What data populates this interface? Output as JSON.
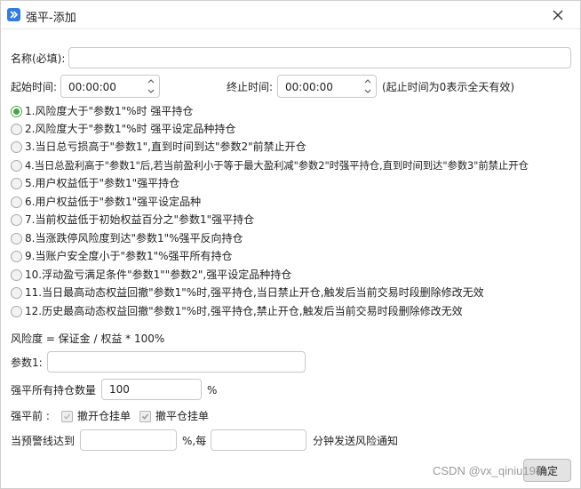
{
  "window": {
    "title": "强平-添加",
    "close_icon": "close-icon"
  },
  "name_field": {
    "label": "名称(必填):",
    "value": ""
  },
  "time": {
    "start_label": "起始时间:",
    "start_value": "00:00:00",
    "end_label": "终止时间:",
    "end_value": "00:00:00",
    "hint": "(起止时间为0表示全天有效)"
  },
  "options": [
    "1.风险度大于\"参数1\"%时 强平持仓",
    "2.风险度大于\"参数1\"%时 强平设定品种持仓",
    "3.当日总亏损高于\"参数1\",直到时间到达\"参数2\"前禁止开仓",
    "4.当日总盈利高于\"参数1\"后,若当前盈利小于等于最大盈利减\"参数2\"时强平持仓,直到时间到达\"参数3\"前禁止开仓",
    "5.用户权益低于\"参数1\"强平持仓",
    "6.用户权益低于\"参数1\"强平设定品种",
    "7.当前权益低于初始权益百分之\"参数1\"强平持仓",
    "8.当涨跌停风险度到达\"参数1\"%强平反向持仓",
    "9.当账户安全度小于\"参数1\"%强平所有持仓",
    "10.浮动盈亏满足条件\"参数1\"\"参数2\",强平设定品种持仓",
    "11.当日最高动态权益回撤\"参数1\"%时,强平持仓,当日禁止开仓,触发后当前交易时段删除修改无效",
    "12.历史最高动态权益回撤\"参数1\"%时,强平持仓,禁止开仓,触发后当前交易时段删除修改无效"
  ],
  "selected_option_index": 0,
  "formula": "风险度 = 保证金 / 权益 * 100%",
  "param1": {
    "label": "参数1:",
    "value": ""
  },
  "quantity": {
    "label": "强平所有持仓数量",
    "value": "100",
    "unit": "%"
  },
  "before_force": {
    "label": "强平前 :",
    "cancel_open_label": "撤开仓挂单",
    "cancel_open_checked": false,
    "cancel_close_label": "撤平仓挂单",
    "cancel_close_checked": true
  },
  "warning": {
    "prefix": "当预警线达到",
    "value": "",
    "middle": "%,每",
    "minutes": "",
    "suffix": "分钟发送风险通知"
  },
  "confirm_label": "确定",
  "watermark": "CSDN @vx_qiniu198"
}
